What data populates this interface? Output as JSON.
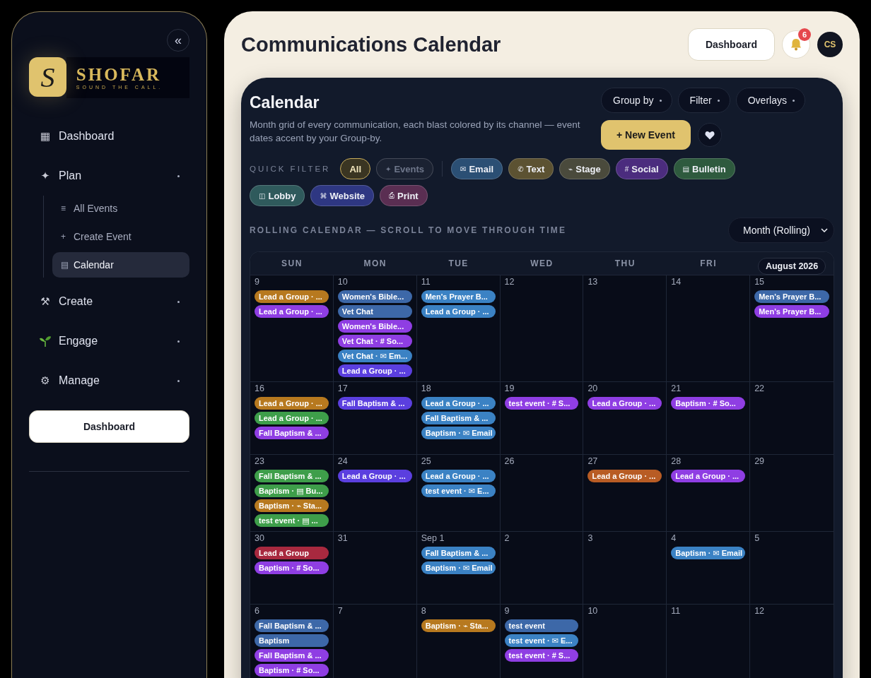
{
  "sidebar": {
    "collapse_icon": "«",
    "logo": {
      "mark": "S",
      "name": "SHOFAR",
      "tagline": "SOUND THE CALL."
    },
    "nav": [
      {
        "label": "Dashboard",
        "icon": "▦",
        "selected": false
      },
      {
        "label": "Plan",
        "icon": "✦",
        "selected": false,
        "children": [
          {
            "label": "All Events",
            "icon": "≡",
            "selected": false
          },
          {
            "label": "Create Event",
            "icon": "+",
            "selected": false
          },
          {
            "label": "Calendar",
            "icon": "▤",
            "selected": true
          }
        ]
      },
      {
        "label": "Create",
        "icon": "⚒",
        "selected": false
      },
      {
        "label": "Engage",
        "selected": false
      },
      {
        "label": "Manage",
        "icon": "⚙",
        "selected": false
      }
    ],
    "button": "Dashboard"
  },
  "header": {
    "title": "Communications Calendar",
    "button": "Dashboard",
    "notifications": "6",
    "avatar": "CS"
  },
  "calendar": {
    "title": "Calendar",
    "description": "Month grid of every communication, each blast colored by its channel — event dates accent by your Group-by.",
    "menus": [
      "Group by",
      "Filter",
      "Overlays"
    ],
    "new_button": "+ New Event",
    "quick_filter": {
      "label": "QUICK FILTER",
      "chips": [
        {
          "label": "All",
          "selected": true,
          "disabled": false
        },
        {
          "icon": "✦",
          "label": "Events",
          "selected": false,
          "disabled": true
        },
        {
          "icon": "✉",
          "label": "Email",
          "selected": false,
          "disabled": false,
          "color": "#2b4f74"
        },
        {
          "icon": "✆",
          "label": "Text",
          "selected": false,
          "disabled": false,
          "color": "#5c5232"
        },
        {
          "icon": "⌁",
          "label": "Stage",
          "selected": false,
          "disabled": false,
          "color": "#4a4a3c"
        },
        {
          "icon": "#",
          "label": "Social",
          "selected": false,
          "disabled": false,
          "color": "#4b2c7e"
        },
        {
          "icon": "▤",
          "label": "Bulletin",
          "selected": false,
          "disabled": false,
          "color": "#2e5a3e"
        },
        {
          "icon": "◫",
          "label": "Lobby",
          "selected": false,
          "disabled": false,
          "color": "#2f5a5c"
        },
        {
          "icon": "⌘",
          "label": "Website",
          "selected": false,
          "disabled": false,
          "color": "#2e3782"
        },
        {
          "icon": "⎙",
          "label": "Print",
          "selected": false,
          "disabled": false,
          "color": "#5a2e52"
        }
      ]
    },
    "rolling_label": "ROLLING CALENDAR — SCROLL TO MOVE THROUGH TIME",
    "view_select": "Month (Rolling)",
    "weekdays": [
      "SUN",
      "MON",
      "TUE",
      "WED",
      "THU",
      "FRI"
    ],
    "month_badge": "August 2026",
    "weeks": [
      {
        "days": [
          {
            "date": "9",
            "events": [
              {
                "title": "Lead a Group · ...",
                "color": "#b7791f"
              },
              {
                "title": "Lead a Group · ...",
                "color": "#8f3ee3"
              }
            ]
          },
          {
            "date": "10",
            "events": [
              {
                "title": "Women's Bible...",
                "color": "#3d68a8"
              },
              {
                "title": "Vet Chat",
                "color": "#3d68a8"
              },
              {
                "title": "Women's Bible...",
                "color": "#8f3ee3"
              },
              {
                "title": "Vet Chat · # So...",
                "color": "#8f3ee3"
              },
              {
                "title": "Vet Chat · ✉ Em...",
                "color": "#3b82c4"
              },
              {
                "title": "Lead a Group · ...",
                "color": "#5b3fdf"
              }
            ]
          },
          {
            "date": "11",
            "events": [
              {
                "title": "Men's Prayer B...",
                "color": "#3b82c4"
              },
              {
                "title": "Lead a Group · ...",
                "color": "#3b82c4"
              }
            ]
          },
          {
            "date": "12"
          },
          {
            "date": "13"
          },
          {
            "date": "14"
          },
          {
            "date": "15",
            "events": [
              {
                "title": "Men's Prayer B...",
                "color": "#3d68a8"
              },
              {
                "title": "Men's Prayer B...",
                "color": "#8f3ee3"
              }
            ]
          }
        ]
      },
      {
        "days": [
          {
            "date": "16",
            "events": [
              {
                "title": "Lead a Group · ...",
                "color": "#b7791f"
              },
              {
                "title": "Lead a Group · ...",
                "color": "#3e9e4a"
              },
              {
                "title": "Fall Baptism & ...",
                "color": "#8f3ee3"
              }
            ]
          },
          {
            "date": "17",
            "events": [
              {
                "title": "Fall Baptism & ...",
                "color": "#5b3fdf"
              }
            ]
          },
          {
            "date": "18",
            "events": [
              {
                "title": "Lead a Group · ...",
                "color": "#3b82c4"
              },
              {
                "title": "Fall Baptism & ...",
                "color": "#3b82c4"
              },
              {
                "title": "Baptism · ✉ Email",
                "color": "#3b82c4"
              }
            ]
          },
          {
            "date": "19",
            "events": [
              {
                "title": "test event · # S...",
                "color": "#8f3ee3"
              }
            ]
          },
          {
            "date": "20",
            "events": [
              {
                "title": "Lead a Group · ...",
                "color": "#8f3ee3"
              }
            ]
          },
          {
            "date": "21",
            "events": [
              {
                "title": "Baptism · # So...",
                "color": "#8f3ee3"
              }
            ]
          },
          {
            "date": "22"
          }
        ]
      },
      {
        "days": [
          {
            "date": "23",
            "events": [
              {
                "title": "Fall Baptism & ...",
                "color": "#3e9e4a"
              },
              {
                "title": "Baptism · ▤ Bu...",
                "color": "#3e9e4a"
              },
              {
                "title": "Baptism · ⌁ Sta...",
                "color": "#b7791f"
              },
              {
                "title": "test event · ▤ ...",
                "color": "#3e9e4a"
              }
            ]
          },
          {
            "date": "24",
            "events": [
              {
                "title": "Lead a Group · ...",
                "color": "#5b3fdf"
              }
            ]
          },
          {
            "date": "25",
            "events": [
              {
                "title": "Lead a Group · ...",
                "color": "#3b82c4"
              },
              {
                "title": "test event · ✉ E...",
                "color": "#3b82c4"
              }
            ]
          },
          {
            "date": "26"
          },
          {
            "date": "27",
            "events": [
              {
                "title": "Lead a Group · ...",
                "color": "#b85c24"
              }
            ]
          },
          {
            "date": "28",
            "events": [
              {
                "title": "Lead a Group · ...",
                "color": "#8f3ee3"
              }
            ]
          },
          {
            "date": "29"
          }
        ]
      },
      {
        "days": [
          {
            "date": "30",
            "events": [
              {
                "title": "Lead a Group",
                "color": "#a8293f"
              },
              {
                "title": "Baptism · # So...",
                "color": "#8f3ee3"
              }
            ]
          },
          {
            "date": "31"
          },
          {
            "date": "Sep 1",
            "events": [
              {
                "title": "Fall Baptism & ...",
                "color": "#3b82c4"
              },
              {
                "title": "Baptism · ✉ Email",
                "color": "#3b82c4"
              }
            ]
          },
          {
            "date": "2"
          },
          {
            "date": "3"
          },
          {
            "date": "4",
            "events": [
              {
                "title": "Baptism · ✉ Email",
                "color": "#3b82c4"
              }
            ]
          },
          {
            "date": "5"
          }
        ]
      },
      {
        "days": [
          {
            "date": "6",
            "events": [
              {
                "title": "Fall Baptism & ...",
                "color": "#3d68a8"
              },
              {
                "title": "Baptism",
                "color": "#3d68a8"
              },
              {
                "title": "Fall Baptism & ...",
                "color": "#8f3ee3"
              },
              {
                "title": "Baptism · # So...",
                "color": "#8f3ee3"
              }
            ]
          },
          {
            "date": "7"
          },
          {
            "date": "8",
            "events": [
              {
                "title": "Baptism · ⌁ Sta...",
                "color": "#b7791f"
              }
            ]
          },
          {
            "date": "9",
            "events": [
              {
                "title": "test event",
                "color": "#3d68a8"
              },
              {
                "title": "test event · ✉ E...",
                "color": "#3b82c4"
              },
              {
                "title": "test event · # S...",
                "color": "#8f3ee3"
              }
            ]
          },
          {
            "date": "10"
          },
          {
            "date": "11"
          },
          {
            "date": "12"
          }
        ]
      }
    ]
  }
}
